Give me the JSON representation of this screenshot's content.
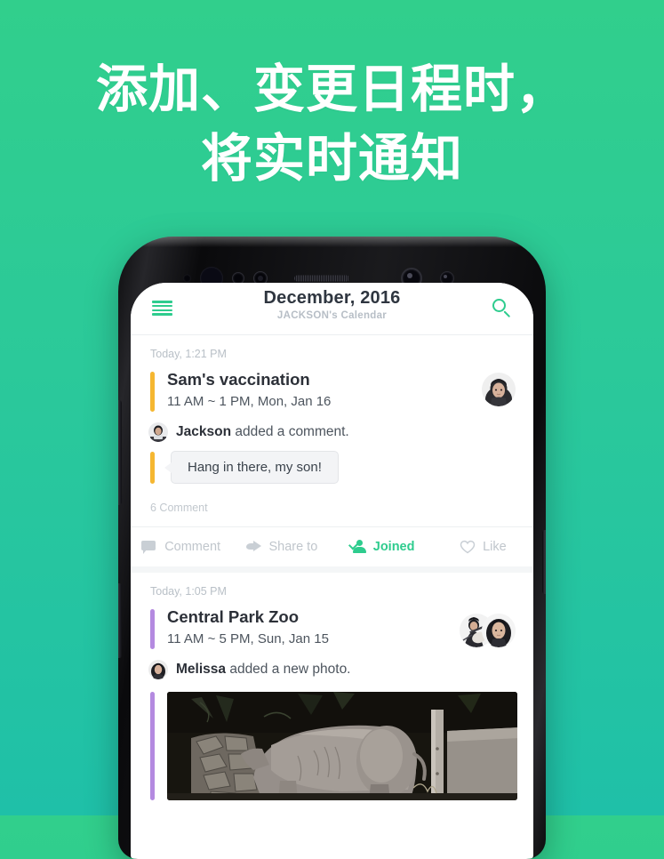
{
  "headline": {
    "line1": "添加、变更日程时，",
    "line2": "将实时通知"
  },
  "colors": {
    "brand_green": "#2ecc8e",
    "bg_gradient_top": "#31cf8c",
    "bg_gradient_bottom": "#1fc0a8",
    "accent_yellow": "#f5b731",
    "accent_purple": "#b48ae0",
    "muted_text": "#b9c0c7"
  },
  "app": {
    "appbar": {
      "menu_icon": "hamburger-menu-icon",
      "title": "December, 2016",
      "subtitle": "JACKSON's Calendar",
      "search_icon": "search-icon"
    },
    "feed": [
      {
        "time": "Today, 1:21 PM",
        "accent": "yellow",
        "event_title": "Sam's vaccination",
        "event_time": "11 AM ~ 1 PM, Mon, Jan 16",
        "avatar": "woman-avatar",
        "activity": {
          "author": "Jackson",
          "text": " added a comment.",
          "avatar": "jackson-avatar"
        },
        "comment_bubble": "Hang in there, my son!",
        "comment_count": "6 Comment",
        "actions": [
          {
            "label": "Comment",
            "icon": "comment-icon",
            "active": false
          },
          {
            "label": "Share to",
            "icon": "share-icon",
            "active": false
          },
          {
            "label": "Joined",
            "icon": "joined-person-check-icon",
            "active": true
          },
          {
            "label": "Like",
            "icon": "heart-icon",
            "active": false
          }
        ]
      },
      {
        "time": "Today, 1:05 PM",
        "accent": "purple",
        "event_title": "Central Park Zoo",
        "event_time": "11 AM ~ 5 PM, Sun, Jan 15",
        "avatars": [
          "man-guitar-avatar",
          "woman-avatar"
        ],
        "activity": {
          "author": "Melissa",
          "text": " added a new photo.",
          "avatar": "melissa-avatar"
        },
        "photo": "rhinoceros-zoo-photo"
      }
    ]
  },
  "device": {
    "frame": "android-phone-frame",
    "buttons": [
      "volume-up-button",
      "volume-down-button",
      "power-button"
    ]
  }
}
